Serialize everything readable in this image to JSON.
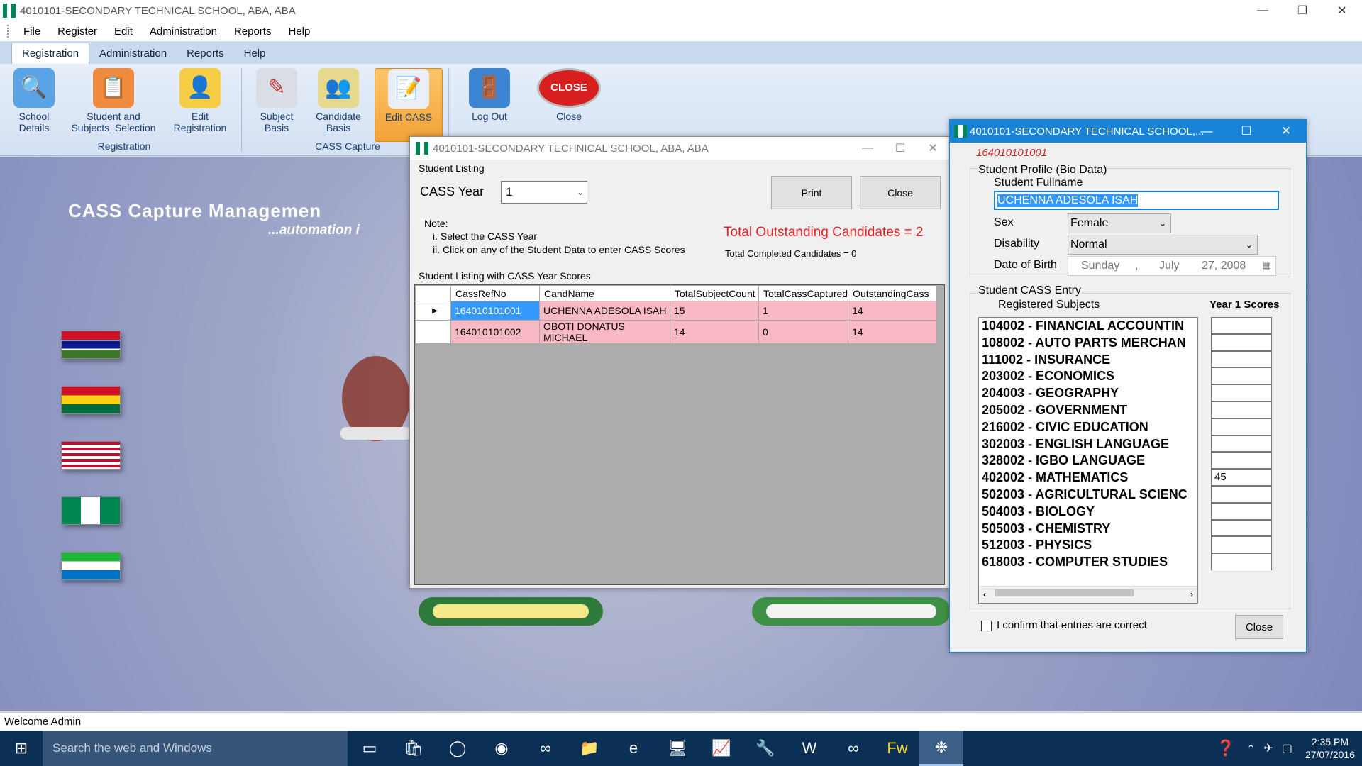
{
  "main_window": {
    "title": "4010101-SECONDARY TECHNICAL SCHOOL, ABA, ABA"
  },
  "menu": [
    "File",
    "Register",
    "Edit",
    "Administration",
    "Reports",
    "Help"
  ],
  "ribbon_tabs": [
    "Registration",
    "Administration",
    "Reports",
    "Help"
  ],
  "ribbon": {
    "buttons": [
      {
        "label": "School Details",
        "icon": "folder-search-icon"
      },
      {
        "label": "Student and Subjects_Selection",
        "icon": "clipboard-checklist-icon"
      },
      {
        "label": "Edit Registration",
        "icon": "user-edit-icon"
      },
      {
        "label": "Subject Basis",
        "icon": "checklist-pen-icon"
      },
      {
        "label": "Candidate Basis",
        "icon": "users-checklist-icon"
      },
      {
        "label": "Edit CASS",
        "icon": "id-card-edit-icon"
      },
      {
        "label": "Log Out",
        "icon": "door-exit-icon"
      },
      {
        "label": "Close",
        "icon": "close-stop-button-icon"
      }
    ],
    "groups": [
      "Registration",
      "CASS Capture"
    ]
  },
  "desktop": {
    "brand_title": "CASS Capture Managemen",
    "brand_tagline": "...automation i"
  },
  "status_bar": {
    "text": "Welcome Admin"
  },
  "listing_window": {
    "title": "4010101-SECONDARY TECHNICAL SCHOOL, ABA, ABA",
    "group_label": "Student Listing",
    "cass_year_label": "CASS Year",
    "cass_year_value": "1",
    "print_label": "Print",
    "close_label": "Close",
    "note_title": "Note:",
    "note_1": "i.  Select the CASS Year",
    "note_2": "ii. Click on any of the Student Data to enter CASS Scores",
    "outstanding_text": "Total Outstanding Candidates = 2",
    "completed_text": "Total Completed Candidates = 0",
    "grid_label": "Student Listing with CASS Year Scores",
    "columns": [
      "CassRefNo",
      "CandName",
      "TotalSubjectCount",
      "TotalCassCaptured",
      "OutstandingCass"
    ],
    "rows": [
      [
        "164010101001",
        "UCHENNA ADESOLA ISAH",
        "15",
        "1",
        "14"
      ],
      [
        "164010101002",
        "OBOTI DONATUS MICHAEL",
        "14",
        "0",
        "14"
      ]
    ]
  },
  "profile_window": {
    "title": "4010101-SECONDARY TECHNICAL SCHOOL,...",
    "ref_no": "164010101001",
    "bio_label": "Student Profile (Bio Data)",
    "fullname_label": "Student Fullname",
    "fullname_value": "UCHENNA ADESOLA ISAH",
    "sex_label": "Sex",
    "sex_value": "Female",
    "disability_label": "Disability",
    "disability_value": "Normal",
    "dob_label": "Date of Birth",
    "dob_day": "Sunday",
    "dob_sep": ",",
    "dob_month": "July",
    "dob_date": "27, 2008",
    "cass_entry_label": "Student CASS Entry",
    "registered_subjects_label": "Registered Subjects",
    "scores_label": "Year 1 Scores",
    "subjects": [
      "104002 - FINANCIAL ACCOUNTIN",
      "108002 - AUTO PARTS MERCHAN",
      "111002 - INSURANCE",
      "203002 - ECONOMICS",
      "204003 - GEOGRAPHY",
      "205002 - GOVERNMENT",
      "216002 - CIVIC EDUCATION",
      "302003 - ENGLISH LANGUAGE",
      "328002 - IGBO LANGUAGE",
      "402002 - MATHEMATICS",
      "502003 - AGRICULTURAL SCIENC",
      "504003 - BIOLOGY",
      "505003 - CHEMISTRY",
      "512003 - PHYSICS",
      "618003 - COMPUTER STUDIES"
    ],
    "scores": [
      "",
      "",
      "",
      "",
      "",
      "",
      "",
      "",
      "",
      "45",
      "",
      "",
      "",
      "",
      ""
    ],
    "confirm_label": "I confirm that entries are correct",
    "close_label": "Close"
  },
  "taskbar": {
    "search_placeholder": "Search the web and Windows",
    "time": "2:35 PM",
    "date": "27/07/2016"
  }
}
